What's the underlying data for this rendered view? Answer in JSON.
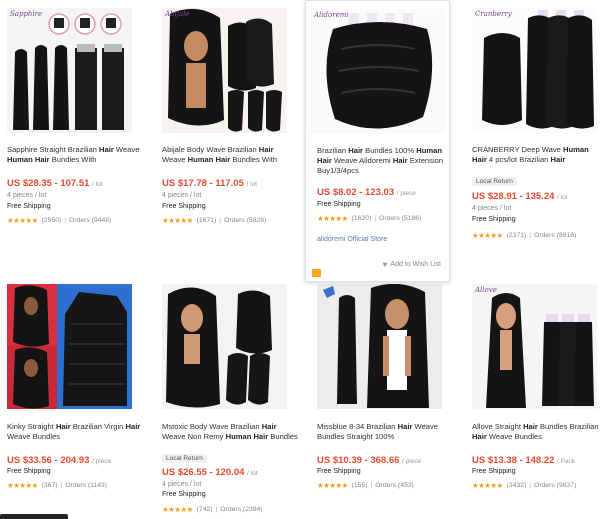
{
  "products": [
    {
      "title_parts": [
        [
          "Sapphire Straight Brazilian ",
          false
        ],
        [
          "Hair",
          true
        ],
        [
          " Weave ",
          false
        ],
        [
          "Human Hair",
          true
        ],
        [
          " Bundles With",
          false
        ]
      ],
      "price": "US $28.35 - 107.51",
      "unit": "/ lot",
      "pieces": "4 pieces / lot",
      "shipping": "Free Shipping",
      "stars": "★★★★★",
      "rating_count": "(2950)",
      "orders": "Orders (9448)",
      "logo": "Sapphire"
    },
    {
      "title_parts": [
        [
          "Abijale Body Wave Brazilian ",
          false
        ],
        [
          "Hair",
          true
        ],
        [
          " Weave ",
          false
        ],
        [
          "Human Hair",
          true
        ],
        [
          " Bundles With",
          false
        ]
      ],
      "price": "US $17.78 - 117.05",
      "unit": "/ lot",
      "pieces": "4 pieces / lot",
      "shipping": "Free Shipping",
      "stars": "★★★★★",
      "rating_count": "(1671)",
      "orders": "Orders (5828)",
      "logo": "Abijale"
    },
    {
      "title_parts": [
        [
          "Brazilian ",
          false
        ],
        [
          "Hair",
          true
        ],
        [
          " Bundles 100% ",
          false
        ],
        [
          "Human Hair",
          true
        ],
        [
          " Weave Alidoremi ",
          false
        ],
        [
          "Hair",
          true
        ],
        [
          " Extension Buy1/3/4pcs",
          false
        ]
      ],
      "price": "US $8.02 - 123.03",
      "unit": "/ piece",
      "shipping": "Free Shipping",
      "stars": "★★★★★",
      "rating_count": "(1620)",
      "orders": "Orders (5186)",
      "store": "alidoremi Official Store",
      "wishlist": "Add to Wish List",
      "logo": "Alidoremi"
    },
    {
      "title_parts": [
        [
          "CRANBERRY Deep Wave ",
          false
        ],
        [
          "Human Hair",
          true
        ],
        [
          " 4 pcs/lot Brazilian ",
          false
        ],
        [
          "Hair",
          true
        ]
      ],
      "badge": "Local Return",
      "price": "US $28.91 - 135.24",
      "unit": "/ lot",
      "pieces": "4 pieces / lot",
      "shipping": "Free Shipping",
      "stars": "★★★★★",
      "rating_count": "(2371)",
      "orders": "Orders (8916)",
      "logo": "Cranberry"
    },
    {
      "title_parts": [
        [
          "Kinky Straight ",
          false
        ],
        [
          "Hair",
          true
        ],
        [
          " Brazilian Virgin ",
          false
        ],
        [
          "Hair",
          true
        ],
        [
          " Weave Bundles",
          false
        ]
      ],
      "price": "US $33.56 - 204.93",
      "unit": "/ piece",
      "shipping": "Free Shipping",
      "stars": "★★★★★",
      "rating_count": "(367)",
      "orders": "Orders (1143)"
    },
    {
      "title_parts": [
        [
          "Mstoxic Body Wave Brazilian ",
          false
        ],
        [
          "Hair",
          true
        ],
        [
          " Weave Non Remy ",
          false
        ],
        [
          "Human Hair",
          true
        ],
        [
          " Bundles",
          false
        ]
      ],
      "badge": "Local Return",
      "price": "US $26.55 - 120.04",
      "unit": "/ lot",
      "pieces": "4 pieces / lot",
      "shipping": "Free Shipping",
      "stars": "★★★★★",
      "rating_count": "(742)",
      "orders": "Orders (2394)"
    },
    {
      "title_parts": [
        [
          "Missblue 8-34 Brazilian ",
          false
        ],
        [
          "Hair",
          true
        ],
        [
          " Weave Bundles Straight 100%",
          false
        ]
      ],
      "price": "US $10.39 - 368.66",
      "unit": "/ piece",
      "shipping": "Free Shipping",
      "stars": "★★★★★",
      "rating_count": "(155)",
      "orders": "Orders (453)"
    },
    {
      "title_parts": [
        [
          "Allove Straight ",
          false
        ],
        [
          "Hair",
          true
        ],
        [
          " Bundles Brazilian ",
          false
        ],
        [
          "Hair",
          true
        ],
        [
          " Weave Bundles",
          false
        ]
      ],
      "price": "US $13.38 - 148.22",
      "unit": "/ Pack",
      "shipping": "Free Shipping",
      "stars": "★★★★★",
      "rating_count": "(3432)",
      "orders": "Orders (9837)",
      "logo": "Allove"
    }
  ],
  "colors": {
    "price": "#e64b2e",
    "star": "#f0a020",
    "hair": "#141414",
    "store_link": "#5a7fa6"
  },
  "icons": {
    "wishlist": "heart-icon",
    "store_bag": "shopping-bag-icon"
  }
}
